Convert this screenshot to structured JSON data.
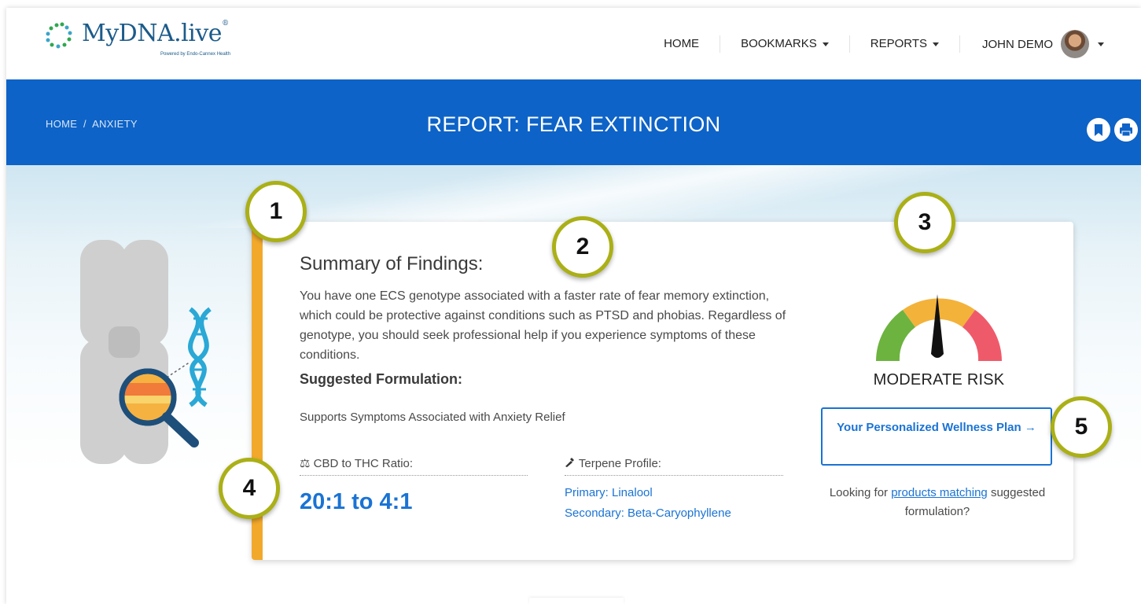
{
  "brand": {
    "name": "MyDNA.live",
    "trademark": "®",
    "tagline": "Powered by Endo-Cannex Health"
  },
  "nav": {
    "home": "HOME",
    "bookmarks": "BOOKMARKS",
    "reports": "REPORTS",
    "user_name": "JOHN DEMO"
  },
  "header": {
    "breadcrumb_home": "HOME",
    "breadcrumb_sep": "/",
    "breadcrumb_current": "ANXIETY",
    "title": "REPORT: FEAR EXTINCTION",
    "bookmark_icon": "bookmark-icon",
    "print_icon": "print-icon"
  },
  "report": {
    "summary_title": "Summary of Findings:",
    "summary_text": "You have one ECS genotype associated with a faster rate of fear memory extinction, which could be protective against conditions such as PTSD and phobias. Regardless of genotype, you should seek professional help if you experience symptoms of these conditions.",
    "formulation_title": "Suggested Formulation:",
    "formulation_text": "Supports Symptoms Associated with Anxiety Relief",
    "ratio_label": "CBD to THC Ratio:",
    "ratio_value": "20:1 to 4:1",
    "terpene_label": "Terpene Profile:",
    "terpene_primary": "Primary: Linalool",
    "terpene_secondary": "Secondary: Beta-Caryophyllene",
    "risk_label": "MODERATE RISK",
    "risk_level": "moderate",
    "plan_button": "Your Personalized Wellness Plan →",
    "looking_prefix": "Looking for ",
    "looking_link": "products matching",
    "looking_suffix": " suggested formulation?"
  },
  "callouts": [
    "1",
    "2",
    "3",
    "4",
    "5"
  ],
  "colors": {
    "primary_blue": "#0d63c7",
    "link_blue": "#1a73d4",
    "accent_orange": "#f2a92b",
    "callout_border": "#aab016",
    "gauge_green": "#6db33f",
    "gauge_yellow": "#f3b23a",
    "gauge_red": "#ef5a6a"
  }
}
